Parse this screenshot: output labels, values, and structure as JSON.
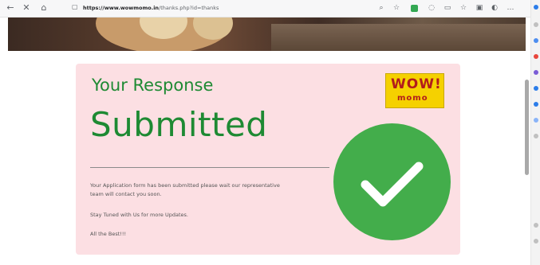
{
  "browser": {
    "url_domain": "https://www.wowmomo.in",
    "url_path": "/thanks.php?id=thanks"
  },
  "card": {
    "heading": "Your Response",
    "big_text": "Submitted",
    "message_1": "Your Application form has been submitted please wait our representative team will contact you soon.",
    "message_2": "Stay Tuned with Us for more Updates.",
    "message_3": "All the Best!!!"
  },
  "logo": {
    "word": "WOW!",
    "sub": "momo"
  },
  "colors": {
    "card_bg": "#fcdfe3",
    "heading_green": "#1e8a33",
    "check_green": "#43ad4b",
    "logo_yellow": "#f5d100"
  }
}
